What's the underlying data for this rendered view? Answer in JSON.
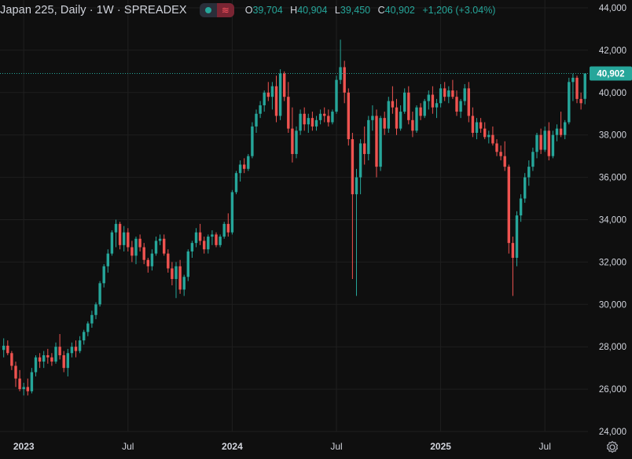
{
  "header": {
    "symbol": "Japan 225, Daily · 1W · SPREADEX",
    "ohlc": {
      "o_label": "O",
      "o_value": "39,704",
      "h_label": "H",
      "h_value": "40,904",
      "l_label": "L",
      "l_value": "39,450",
      "c_label": "C",
      "c_value": "40,902",
      "change": "+1,206 (+3.04%)"
    }
  },
  "colors": {
    "background": "#0f0f0f",
    "grid": "#1f1f1f",
    "up": "#26a69a",
    "down": "#ef5350",
    "text": "#d1d4dc",
    "price_tag": "#26a69a"
  },
  "chart_data": {
    "type": "candlestick",
    "title": "Japan 225, Daily · 1W · SPREADEX",
    "ylim": [
      24000,
      44000
    ],
    "y_ticks": [
      "24,000",
      "26,000",
      "28,000",
      "30,000",
      "32,000",
      "34,000",
      "36,000",
      "38,000",
      "40,000",
      "42,000",
      "44,000"
    ],
    "x_ticks": [
      "2023",
      "Jul",
      "2024",
      "Jul",
      "2025",
      "Jul"
    ],
    "x_tick_index": [
      5,
      31,
      57,
      83,
      109,
      135
    ],
    "last_price": "40,902",
    "candles": [
      [
        27850,
        28400,
        27500,
        28050
      ],
      [
        28050,
        28300,
        27600,
        27700
      ],
      [
        27700,
        27800,
        26900,
        27100
      ],
      [
        27100,
        27300,
        26100,
        26500
      ],
      [
        26500,
        26900,
        25900,
        26000
      ],
      [
        26000,
        26300,
        25700,
        26100
      ],
      [
        26100,
        26500,
        25700,
        25900
      ],
      [
        25900,
        27000,
        25800,
        26800
      ],
      [
        26800,
        27600,
        26600,
        27500
      ],
      [
        27500,
        27700,
        27000,
        27300
      ],
      [
        27300,
        27800,
        27000,
        27600
      ],
      [
        27600,
        27900,
        27200,
        27500
      ],
      [
        27500,
        27700,
        27100,
        27300
      ],
      [
        27300,
        28200,
        27200,
        28000
      ],
      [
        28000,
        28600,
        27400,
        27600
      ],
      [
        27600,
        27800,
        26800,
        27000
      ],
      [
        27000,
        27900,
        26600,
        27700
      ],
      [
        27700,
        28200,
        27500,
        28000
      ],
      [
        28000,
        28300,
        27500,
        27800
      ],
      [
        27800,
        28500,
        27700,
        28300
      ],
      [
        28300,
        28800,
        28100,
        28700
      ],
      [
        28700,
        29200,
        28500,
        29100
      ],
      [
        29100,
        29700,
        28900,
        29500
      ],
      [
        29500,
        30100,
        29300,
        30000
      ],
      [
        30000,
        31100,
        29900,
        31000
      ],
      [
        31000,
        31900,
        30800,
        31800
      ],
      [
        31800,
        32600,
        31500,
        32400
      ],
      [
        32400,
        33500,
        32300,
        33400
      ],
      [
        33400,
        34000,
        32700,
        33800
      ],
      [
        33800,
        33900,
        32600,
        32800
      ],
      [
        32800,
        33700,
        32500,
        33400
      ],
      [
        33400,
        33600,
        32500,
        32700
      ],
      [
        32700,
        33000,
        32000,
        32300
      ],
      [
        32300,
        33200,
        31900,
        33100
      ],
      [
        33100,
        33300,
        32500,
        32700
      ],
      [
        32700,
        32900,
        31900,
        32100
      ],
      [
        32100,
        32200,
        31500,
        31800
      ],
      [
        31800,
        32600,
        31600,
        32400
      ],
      [
        32400,
        33200,
        32300,
        33000
      ],
      [
        33000,
        33300,
        32800,
        33100
      ],
      [
        33100,
        33300,
        32300,
        32400
      ],
      [
        32400,
        32600,
        31500,
        31700
      ],
      [
        31700,
        32000,
        30900,
        31200
      ],
      [
        31200,
        32000,
        30300,
        31800
      ],
      [
        31800,
        32100,
        30500,
        30700
      ],
      [
        30700,
        31400,
        30400,
        31300
      ],
      [
        31300,
        32600,
        31100,
        32500
      ],
      [
        32500,
        33000,
        32200,
        32900
      ],
      [
        32900,
        33600,
        32700,
        33400
      ],
      [
        33400,
        33800,
        32800,
        33000
      ],
      [
        33000,
        33200,
        32400,
        32600
      ],
      [
        32600,
        33300,
        32400,
        33200
      ],
      [
        33200,
        33500,
        32800,
        33300
      ],
      [
        33300,
        33400,
        32700,
        32800
      ],
      [
        32800,
        33300,
        32700,
        33200
      ],
      [
        33200,
        33900,
        33100,
        33800
      ],
      [
        33800,
        34300,
        33200,
        33400
      ],
      [
        33400,
        35400,
        33300,
        35300
      ],
      [
        35300,
        36300,
        35200,
        36200
      ],
      [
        36200,
        36800,
        35800,
        36600
      ],
      [
        36600,
        36900,
        36200,
        36400
      ],
      [
        36400,
        37100,
        36300,
        37000
      ],
      [
        37000,
        38600,
        36900,
        38400
      ],
      [
        38400,
        39200,
        38100,
        39000
      ],
      [
        39000,
        39600,
        38800,
        39400
      ],
      [
        39400,
        40100,
        39100,
        40000
      ],
      [
        40000,
        40500,
        39600,
        39800
      ],
      [
        39800,
        40500,
        39200,
        40300
      ],
      [
        40300,
        40800,
        38600,
        38900
      ],
      [
        38900,
        41100,
        38700,
        40900
      ],
      [
        40900,
        41000,
        39600,
        39800
      ],
      [
        39800,
        40500,
        38100,
        38300
      ],
      [
        38300,
        39300,
        36700,
        37100
      ],
      [
        37100,
        38400,
        36900,
        38200
      ],
      [
        38200,
        39200,
        38000,
        39000
      ],
      [
        39000,
        39300,
        38200,
        38500
      ],
      [
        38500,
        39000,
        38100,
        38800
      ],
      [
        38800,
        39100,
        38200,
        38400
      ],
      [
        38400,
        38900,
        38200,
        38700
      ],
      [
        38700,
        39200,
        38500,
        39000
      ],
      [
        39000,
        39300,
        38600,
        38900
      ],
      [
        38900,
        39200,
        38400,
        38600
      ],
      [
        38600,
        39200,
        38500,
        39100
      ],
      [
        39100,
        40800,
        39000,
        40600
      ],
      [
        40600,
        42500,
        40400,
        41200
      ],
      [
        41200,
        41500,
        39500,
        40000
      ],
      [
        40000,
        40200,
        37500,
        37800
      ],
      [
        37800,
        38100,
        31200,
        35200
      ],
      [
        35200,
        36400,
        30400,
        36000
      ],
      [
        36000,
        37800,
        35200,
        37600
      ],
      [
        37600,
        38400,
        36600,
        37100
      ],
      [
        37100,
        38900,
        36800,
        38700
      ],
      [
        38700,
        39400,
        38200,
        38900
      ],
      [
        38900,
        39200,
        36000,
        36500
      ],
      [
        36500,
        38900,
        36300,
        38800
      ],
      [
        38800,
        39100,
        38000,
        38300
      ],
      [
        38300,
        39800,
        38100,
        39600
      ],
      [
        39600,
        40300,
        39000,
        39300
      ],
      [
        39300,
        39700,
        38000,
        38300
      ],
      [
        38300,
        39400,
        38200,
        39100
      ],
      [
        39100,
        40200,
        39000,
        40000
      ],
      [
        40000,
        40300,
        38500,
        38700
      ],
      [
        38700,
        39100,
        37900,
        38200
      ],
      [
        38200,
        39400,
        38100,
        39300
      ],
      [
        39300,
        39500,
        38700,
        38900
      ],
      [
        38900,
        39700,
        38800,
        39600
      ],
      [
        39600,
        40100,
        39200,
        39900
      ],
      [
        39900,
        40300,
        39000,
        39300
      ],
      [
        39300,
        39700,
        38800,
        39500
      ],
      [
        39500,
        40400,
        39300,
        40200
      ],
      [
        40200,
        40500,
        39600,
        39800
      ],
      [
        39800,
        40300,
        39500,
        40100
      ],
      [
        40100,
        40600,
        39700,
        39800
      ],
      [
        39800,
        40100,
        38900,
        39100
      ],
      [
        39100,
        39700,
        38800,
        39600
      ],
      [
        39600,
        40400,
        39400,
        40200
      ],
      [
        40200,
        40500,
        38600,
        38900
      ],
      [
        38900,
        39300,
        37900,
        38100
      ],
      [
        38100,
        38800,
        37800,
        38600
      ],
      [
        38600,
        38800,
        38100,
        38300
      ],
      [
        38300,
        38600,
        37800,
        37900
      ],
      [
        37900,
        38200,
        37600,
        38000
      ],
      [
        38000,
        38400,
        37500,
        37600
      ],
      [
        37600,
        37800,
        37000,
        37200
      ],
      [
        37200,
        37500,
        36800,
        37000
      ],
      [
        37000,
        37700,
        36300,
        36500
      ],
      [
        36500,
        36600,
        32400,
        32900
      ],
      [
        32900,
        33200,
        30400,
        32200
      ],
      [
        32200,
        34400,
        31800,
        34200
      ],
      [
        34200,
        35200,
        33900,
        35000
      ],
      [
        35000,
        36200,
        34800,
        36000
      ],
      [
        36000,
        36800,
        35600,
        36500
      ],
      [
        36500,
        37400,
        36300,
        37200
      ],
      [
        37200,
        38100,
        36900,
        38000
      ],
      [
        38000,
        38300,
        37100,
        37300
      ],
      [
        37300,
        38400,
        37200,
        38200
      ],
      [
        38200,
        38600,
        36800,
        37000
      ],
      [
        37000,
        38200,
        36900,
        38000
      ],
      [
        38000,
        38500,
        37700,
        38300
      ],
      [
        38300,
        39100,
        37900,
        38000
      ],
      [
        38000,
        38700,
        37800,
        38600
      ],
      [
        38600,
        40700,
        38500,
        40500
      ],
      [
        40500,
        40900,
        39600,
        40700
      ],
      [
        40700,
        40800,
        39500,
        39700
      ],
      [
        39700,
        40000,
        39200,
        39500
      ],
      [
        39704,
        40904,
        39450,
        40902
      ]
    ]
  }
}
